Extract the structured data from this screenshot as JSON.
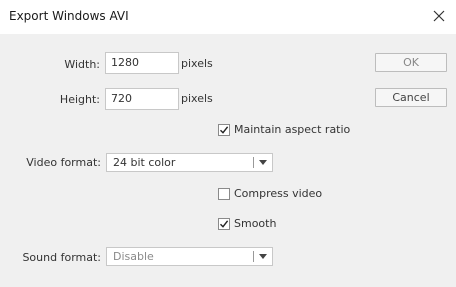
{
  "window": {
    "title": "Export Windows AVI"
  },
  "fields": {
    "width": {
      "label": "Width:",
      "value": "1280",
      "unit": "pixels"
    },
    "height": {
      "label": "Height:",
      "value": "720",
      "unit": "pixels"
    },
    "maintain_aspect": {
      "label": "Maintain aspect ratio",
      "checked": true
    },
    "video_format": {
      "label": "Video format:",
      "value": "24 bit color"
    },
    "compress_video": {
      "label": "Compress video",
      "checked": false
    },
    "smooth": {
      "label": "Smooth",
      "checked": true
    },
    "sound_format": {
      "label": "Sound format:",
      "value": "Disable"
    }
  },
  "buttons": {
    "ok": "OK",
    "cancel": "Cancel"
  },
  "icons": {
    "close": "close-icon",
    "dropdown": "chevron-down-icon",
    "checkmark": "checkmark-icon"
  }
}
